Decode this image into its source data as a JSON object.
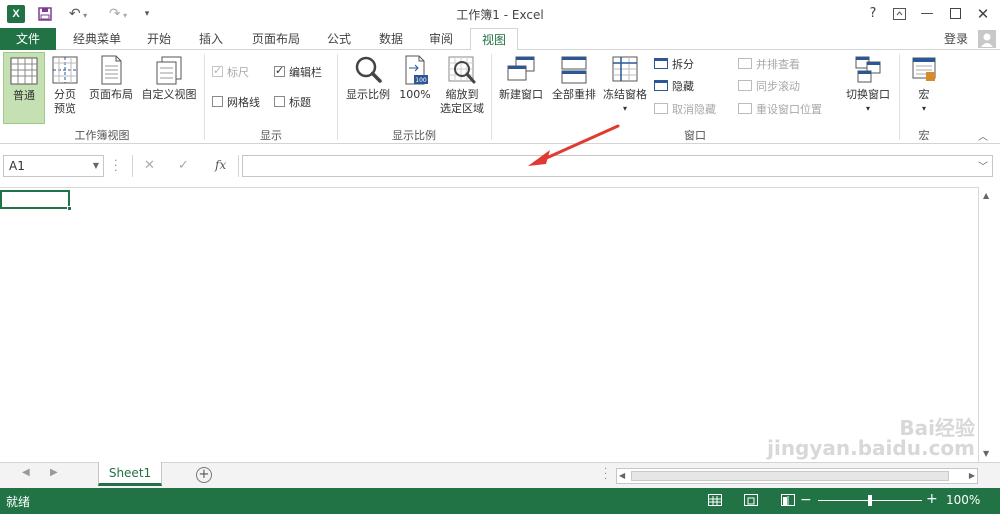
{
  "titlebar": {
    "title": "工作簿1 - Excel",
    "app_icon": "excel-icon",
    "help": "?",
    "login": "登录"
  },
  "tabs": [
    "文件",
    "经典菜单",
    "开始",
    "插入",
    "页面布局",
    "公式",
    "数据",
    "审阅",
    "视图"
  ],
  "active_tab": "视图",
  "ribbon": {
    "workbook_views": {
      "label": "工作簿视图",
      "normal": "普通",
      "page_break_line1": "分页",
      "page_break_line2": "预览",
      "page_layout": "页面布局",
      "custom_views": "自定义视图"
    },
    "show": {
      "label": "显示",
      "ruler": "标尺",
      "formula_bar": "编辑栏",
      "gridlines": "网格线",
      "headings": "标题"
    },
    "zoom": {
      "label": "显示比例",
      "zoom": "显示比例",
      "hundred": "100%",
      "zoom_sel_line1": "缩放到",
      "zoom_sel_line2": "选定区域"
    },
    "window": {
      "label": "窗口",
      "new_window": "新建窗口",
      "arrange_all": "全部重排",
      "freeze_panes": "冻结窗格",
      "split": "拆分",
      "hide": "隐藏",
      "unhide": "取消隐藏",
      "side_by_side": "并排查看",
      "sync_scroll": "同步滚动",
      "reset_position": "重设窗口位置",
      "switch_windows": "切换窗口"
    },
    "macros": {
      "label": "宏",
      "macros": "宏"
    }
  },
  "formula_bar": {
    "name_box": "A1",
    "fx": "fx",
    "content": ""
  },
  "sheets": [
    "Sheet1"
  ],
  "status": {
    "ready": "就绪",
    "zoom": "100%"
  },
  "watermark": "Bai经验 jingyan.baidu.com",
  "colors": {
    "accent": "#217346",
    "arrow": "#e03a33"
  }
}
